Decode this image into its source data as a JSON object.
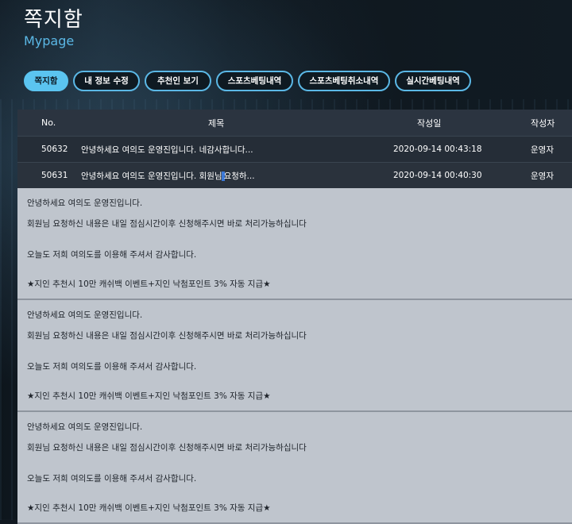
{
  "header": {
    "title": "쪽지함",
    "subtitle": "Mypage"
  },
  "tabs": [
    {
      "label": "쪽지함"
    },
    {
      "label": "내 정보 수정"
    },
    {
      "label": "추천인 보기"
    },
    {
      "label": "스포츠베팅내역"
    },
    {
      "label": "스포츠베팅취소내역"
    },
    {
      "label": "실시간베팅내역"
    }
  ],
  "table": {
    "headers": {
      "no": "No.",
      "title": "제목",
      "date": "작성일",
      "author": "작성자"
    },
    "rows": [
      {
        "no": "50632",
        "title": "안녕하세요 여의도 운영진입니다. 네감사합니다...",
        "date": "2020-09-14 00:43:18",
        "author": "운영자"
      },
      {
        "no": "50631",
        "title_a": "안녕하세요 여의도 운영진입니다. 회원님",
        "title_b": "요청하...",
        "date": "2020-09-14 00:40:30",
        "author": "운영자"
      }
    ]
  },
  "messages": [
    {
      "line1": "안녕하세요 여의도 운영진입니다.",
      "line2": "회원님 요청하신 내용은 내일 점심시간이후 신청해주시면 바로 처리가능하십니다",
      "line3": "오늘도 저희 여의도를 이용해 주셔서 감사합니다.",
      "line4": "★지인 추천시 10만 캐쉬백 이벤트+지인 낙첨포인트 3% 자동 지급★"
    },
    {
      "line1": "안녕하세요 여의도 운영진입니다.",
      "line2": "회원님 요청하신 내용은 내일 점심시간이후 신청해주시면 바로 처리가능하십니다",
      "line3": "오늘도 저희 여의도를 이용해 주셔서 감사합니다.",
      "line4": "★지인 추천시 10만 캐쉬백 이벤트+지인 낙첨포인트 3% 자동 지급★"
    },
    {
      "line1": "안녕하세요 여의도 운영진입니다.",
      "line2": "회원님 요청하신 내용은 내일 점심시간이후 신청해주시면 바로 처리가능하십니다",
      "line3": "오늘도 저희 여의도를 이용해 주셔서 감사합니다.",
      "line4": "★지인 추천시 10만 캐쉬백 이벤트+지인 낙첨포인트 3% 자동 지급★"
    }
  ],
  "colors": {
    "accent": "#5bb8e6",
    "active_tab": "#5bc4f0",
    "table_header": "#2b3440",
    "message_bg": "#bfc5cd"
  }
}
